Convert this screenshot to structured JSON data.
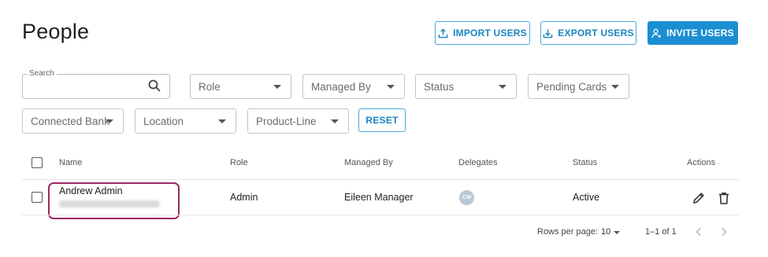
{
  "header": {
    "title": "People",
    "import_label": "IMPORT USERS",
    "export_label": "EXPORT USERS",
    "invite_label": "INVITE USERS"
  },
  "filters": {
    "search_label": "Search",
    "search_value": "",
    "role": "Role",
    "managed_by": "Managed By",
    "status": "Status",
    "pending_cards": "Pending Cards",
    "connected_bank": "Connected Bank",
    "location": "Location",
    "product_line": "Product-Line",
    "reset_label": "RESET"
  },
  "table": {
    "columns": [
      "Name",
      "Role",
      "Managed By",
      "Delegates",
      "Status",
      "Actions"
    ],
    "rows": [
      {
        "name": "Andrew Admin",
        "role": "Admin",
        "managed_by": "Eileen Manager",
        "delegate_initials": "CW",
        "status": "Active"
      }
    ]
  },
  "pagination": {
    "rows_per_page_label": "Rows per page:",
    "rows_per_page": "10",
    "range": "1–1 of 1"
  },
  "colors": {
    "accent": "#1b8fd2",
    "highlight": "#9c2a63"
  },
  "icons": [
    "upload-icon",
    "download-icon",
    "user-plus-icon",
    "search-icon",
    "pencil-icon",
    "trash-icon",
    "chevron-left-icon",
    "chevron-right-icon"
  ]
}
